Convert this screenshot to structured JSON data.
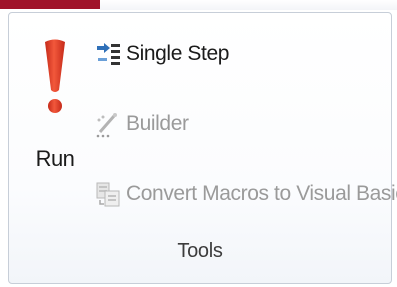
{
  "ribbon": {
    "group": {
      "label": "Tools",
      "run": {
        "label": "Run",
        "icon": "exclamation-icon"
      },
      "commands": [
        {
          "label": "Single Step",
          "icon": "single-step-icon",
          "enabled": true
        },
        {
          "label": "Builder",
          "icon": "builder-wand-icon",
          "enabled": false
        },
        {
          "label": "Convert Macros to Visual Basic",
          "icon": "convert-macros-icon",
          "enabled": false
        }
      ]
    }
  },
  "colors": {
    "accent": "#a0132a",
    "run_icon": "#e8412c",
    "text": "#1b1b1b",
    "disabled_text": "#9a9a9a",
    "icon_blue": "#2e6fb8"
  }
}
